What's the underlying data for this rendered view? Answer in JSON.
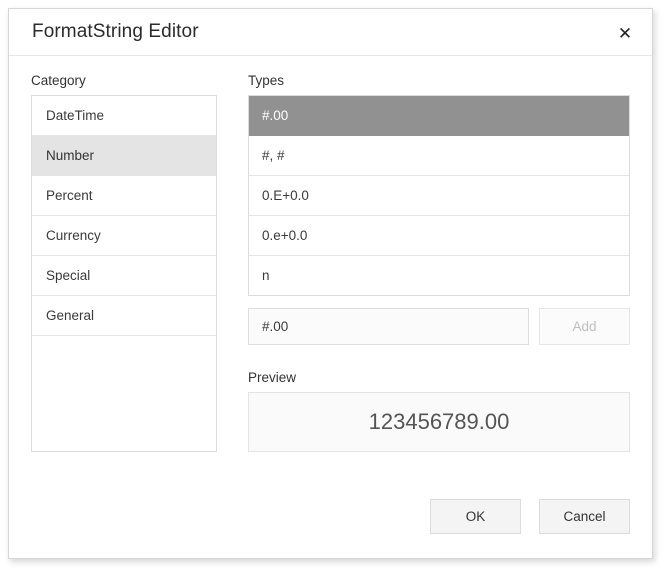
{
  "dialog": {
    "title": "FormatString Editor",
    "close_label": "✕"
  },
  "category": {
    "label": "Category",
    "items": [
      {
        "label": "DateTime",
        "selected": false
      },
      {
        "label": "Number",
        "selected": true
      },
      {
        "label": "Percent",
        "selected": false
      },
      {
        "label": "Currency",
        "selected": false
      },
      {
        "label": "Special",
        "selected": false
      },
      {
        "label": "General",
        "selected": false
      }
    ]
  },
  "types": {
    "label": "Types",
    "items": [
      {
        "label": "#.00",
        "selected": true
      },
      {
        "label": "#, #",
        "selected": false
      },
      {
        "label": "0.E+0.0",
        "selected": false
      },
      {
        "label": "0.e+0.0",
        "selected": false
      },
      {
        "label": "n",
        "selected": false
      }
    ]
  },
  "format_input": {
    "value": "#.00",
    "placeholder": ""
  },
  "add_button": {
    "label": "Add",
    "disabled": true
  },
  "preview": {
    "label": "Preview",
    "value": "123456789.00"
  },
  "footer": {
    "ok_label": "OK",
    "cancel_label": "Cancel"
  },
  "colors": {
    "selected_type_bg": "#919191",
    "selected_category_bg": "#e4e4e4",
    "border": "#dcdcdc",
    "preview_bg": "#fafafa",
    "disabled_text": "#bfbfbf"
  }
}
